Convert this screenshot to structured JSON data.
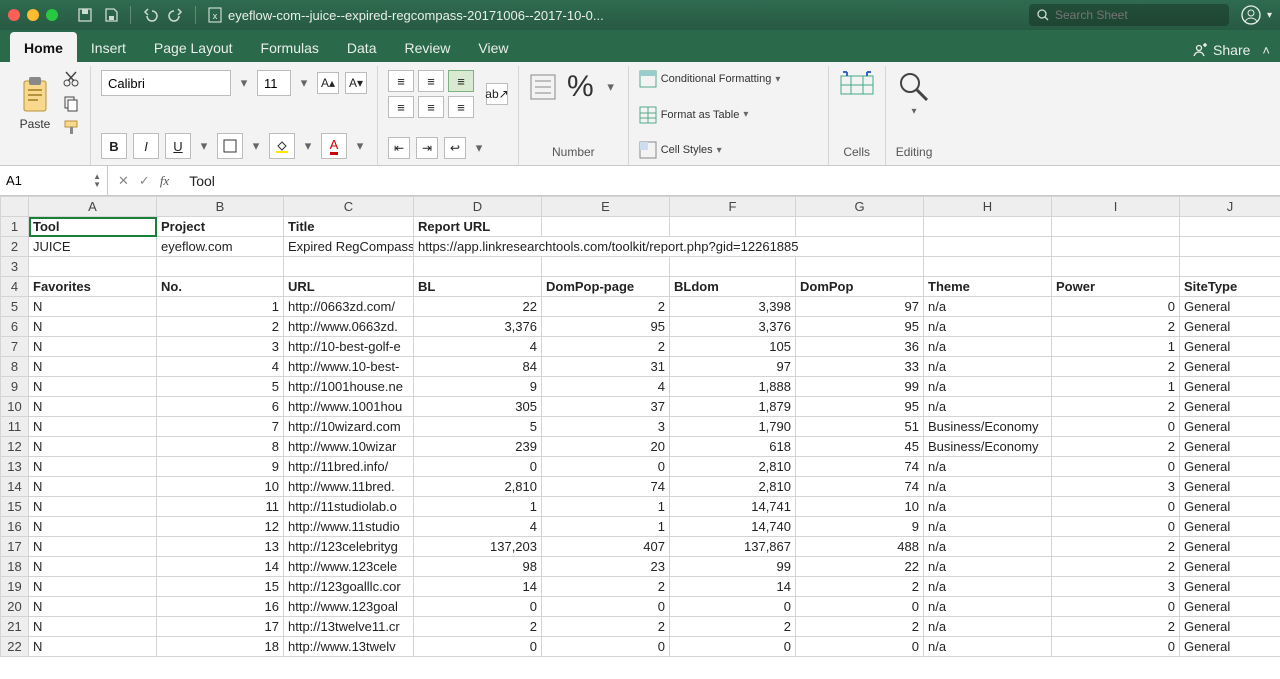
{
  "titlebar": {
    "filename": "eyeflow-com--juice--expired-regcompass-20171006--2017-10-0...",
    "search_placeholder": "Search Sheet"
  },
  "tabs": [
    "Home",
    "Insert",
    "Page Layout",
    "Formulas",
    "Data",
    "Review",
    "View"
  ],
  "share_label": "Share",
  "ribbon": {
    "paste": "Paste",
    "font_name": "Calibri",
    "font_size": "11",
    "number": "Number",
    "cond_fmt": "Conditional Formatting",
    "fmt_table": "Format as Table",
    "cell_styles": "Cell Styles",
    "cells": "Cells",
    "editing": "Editing"
  },
  "namebox": "A1",
  "formula": "Tool",
  "columns": [
    "A",
    "B",
    "C",
    "D",
    "E",
    "F",
    "G",
    "H",
    "I",
    "J"
  ],
  "meta_rows": {
    "r1": {
      "A": "Tool",
      "B": "Project",
      "C": "Title",
      "D": "Report URL"
    },
    "r2": {
      "A": "JUICE",
      "B": "eyeflow.com",
      "C": "Expired RegCompass",
      "D": "https://app.linkresearchtools.com/toolkit/report.php?gid=12261885"
    },
    "r4": {
      "A": "Favorites",
      "B": "No.",
      "C": "URL",
      "D": "BL",
      "E": "DomPop-page",
      "F": "BLdom",
      "G": "DomPop",
      "H": "Theme",
      "I": "Power",
      "J": "SiteType"
    }
  },
  "data_rows": [
    {
      "row": 5,
      "fav": "N",
      "no": 1,
      "url": "http://0663zd.com/",
      "bl": "22",
      "dpp": "2",
      "bldom": "3,398",
      "dompop": "97",
      "theme": "n/a",
      "power": "0",
      "sitetype": "General"
    },
    {
      "row": 6,
      "fav": "N",
      "no": 2,
      "url": "http://www.0663zd.",
      "bl": "3,376",
      "dpp": "95",
      "bldom": "3,376",
      "dompop": "95",
      "theme": "n/a",
      "power": "2",
      "sitetype": "General"
    },
    {
      "row": 7,
      "fav": "N",
      "no": 3,
      "url": "http://10-best-golf-e",
      "bl": "4",
      "dpp": "2",
      "bldom": "105",
      "dompop": "36",
      "theme": "n/a",
      "power": "1",
      "sitetype": "General"
    },
    {
      "row": 8,
      "fav": "N",
      "no": 4,
      "url": "http://www.10-best-",
      "bl": "84",
      "dpp": "31",
      "bldom": "97",
      "dompop": "33",
      "theme": "n/a",
      "power": "2",
      "sitetype": "General"
    },
    {
      "row": 9,
      "fav": "N",
      "no": 5,
      "url": "http://1001house.ne",
      "bl": "9",
      "dpp": "4",
      "bldom": "1,888",
      "dompop": "99",
      "theme": "n/a",
      "power": "1",
      "sitetype": "General"
    },
    {
      "row": 10,
      "fav": "N",
      "no": 6,
      "url": "http://www.1001hou",
      "bl": "305",
      "dpp": "37",
      "bldom": "1,879",
      "dompop": "95",
      "theme": "n/a",
      "power": "2",
      "sitetype": "General"
    },
    {
      "row": 11,
      "fav": "N",
      "no": 7,
      "url": "http://10wizard.com",
      "bl": "5",
      "dpp": "3",
      "bldom": "1,790",
      "dompop": "51",
      "theme": "Business/Economy",
      "power": "0",
      "sitetype": "General"
    },
    {
      "row": 12,
      "fav": "N",
      "no": 8,
      "url": "http://www.10wizar",
      "bl": "239",
      "dpp": "20",
      "bldom": "618",
      "dompop": "45",
      "theme": "Business/Economy",
      "power": "2",
      "sitetype": "General"
    },
    {
      "row": 13,
      "fav": "N",
      "no": 9,
      "url": "http://11bred.info/",
      "bl": "0",
      "dpp": "0",
      "bldom": "2,810",
      "dompop": "74",
      "theme": "n/a",
      "power": "0",
      "sitetype": "General"
    },
    {
      "row": 14,
      "fav": "N",
      "no": 10,
      "url": "http://www.11bred.",
      "bl": "2,810",
      "dpp": "74",
      "bldom": "2,810",
      "dompop": "74",
      "theme": "n/a",
      "power": "3",
      "sitetype": "General"
    },
    {
      "row": 15,
      "fav": "N",
      "no": 11,
      "url": "http://11studiolab.o",
      "bl": "1",
      "dpp": "1",
      "bldom": "14,741",
      "dompop": "10",
      "theme": "n/a",
      "power": "0",
      "sitetype": "General"
    },
    {
      "row": 16,
      "fav": "N",
      "no": 12,
      "url": "http://www.11studio",
      "bl": "4",
      "dpp": "1",
      "bldom": "14,740",
      "dompop": "9",
      "theme": "n/a",
      "power": "0",
      "sitetype": "General"
    },
    {
      "row": 17,
      "fav": "N",
      "no": 13,
      "url": "http://123celebrityg",
      "bl": "137,203",
      "dpp": "407",
      "bldom": "137,867",
      "dompop": "488",
      "theme": "n/a",
      "power": "2",
      "sitetype": "General"
    },
    {
      "row": 18,
      "fav": "N",
      "no": 14,
      "url": "http://www.123cele",
      "bl": "98",
      "dpp": "23",
      "bldom": "99",
      "dompop": "22",
      "theme": "n/a",
      "power": "2",
      "sitetype": "General"
    },
    {
      "row": 19,
      "fav": "N",
      "no": 15,
      "url": "http://123goalllc.cor",
      "bl": "14",
      "dpp": "2",
      "bldom": "14",
      "dompop": "2",
      "theme": "n/a",
      "power": "3",
      "sitetype": "General"
    },
    {
      "row": 20,
      "fav": "N",
      "no": 16,
      "url": "http://www.123goal",
      "bl": "0",
      "dpp": "0",
      "bldom": "0",
      "dompop": "0",
      "theme": "n/a",
      "power": "0",
      "sitetype": "General"
    },
    {
      "row": 21,
      "fav": "N",
      "no": 17,
      "url": "http://13twelve11.cr",
      "bl": "2",
      "dpp": "2",
      "bldom": "2",
      "dompop": "2",
      "theme": "n/a",
      "power": "2",
      "sitetype": "General"
    },
    {
      "row": 22,
      "fav": "N",
      "no": 18,
      "url": "http://www.13twelv",
      "bl": "0",
      "dpp": "0",
      "bldom": "0",
      "dompop": "0",
      "theme": "n/a",
      "power": "0",
      "sitetype": "General"
    }
  ]
}
